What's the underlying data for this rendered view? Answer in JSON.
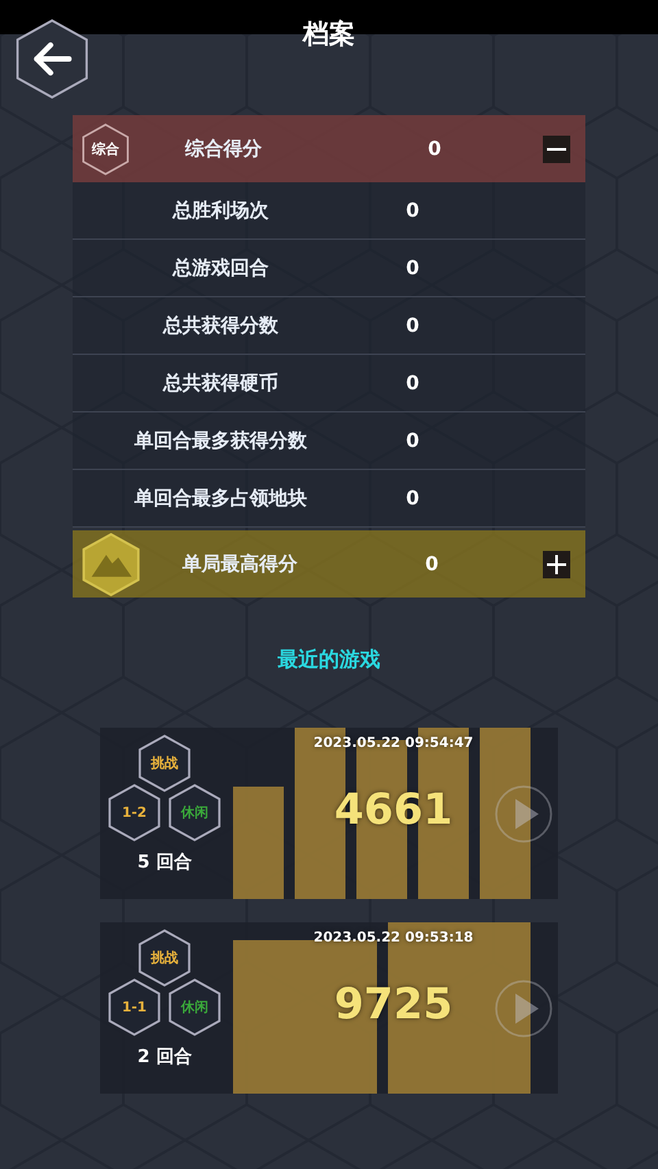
{
  "title": "档案",
  "stats": {
    "summary": {
      "badge": "综合",
      "label": "综合得分",
      "value": "0",
      "expanded": true
    },
    "rows": [
      {
        "label": "总胜利场次",
        "value": "0"
      },
      {
        "label": "总游戏回合",
        "value": "0"
      },
      {
        "label": "总共获得分数",
        "value": "0"
      },
      {
        "label": "总共获得硬币",
        "value": "0"
      },
      {
        "label": "单回合最多获得分数",
        "value": "0"
      },
      {
        "label": "单回合最多占领地块",
        "value": "0"
      }
    ],
    "best": {
      "label": "单局最高得分",
      "value": "0",
      "expanded": false
    }
  },
  "recent_title": "最近的游戏",
  "games": [
    {
      "mode": "挑战",
      "stage": "1-2",
      "type": "休闲",
      "rounds": "5 回合",
      "time": "2023.05.22 09:54:47",
      "score": "4661"
    },
    {
      "mode": "挑战",
      "stage": "1-1",
      "type": "休闲",
      "rounds": "2 回合",
      "time": "2023.05.22 09:53:18",
      "score": "9725"
    }
  ]
}
